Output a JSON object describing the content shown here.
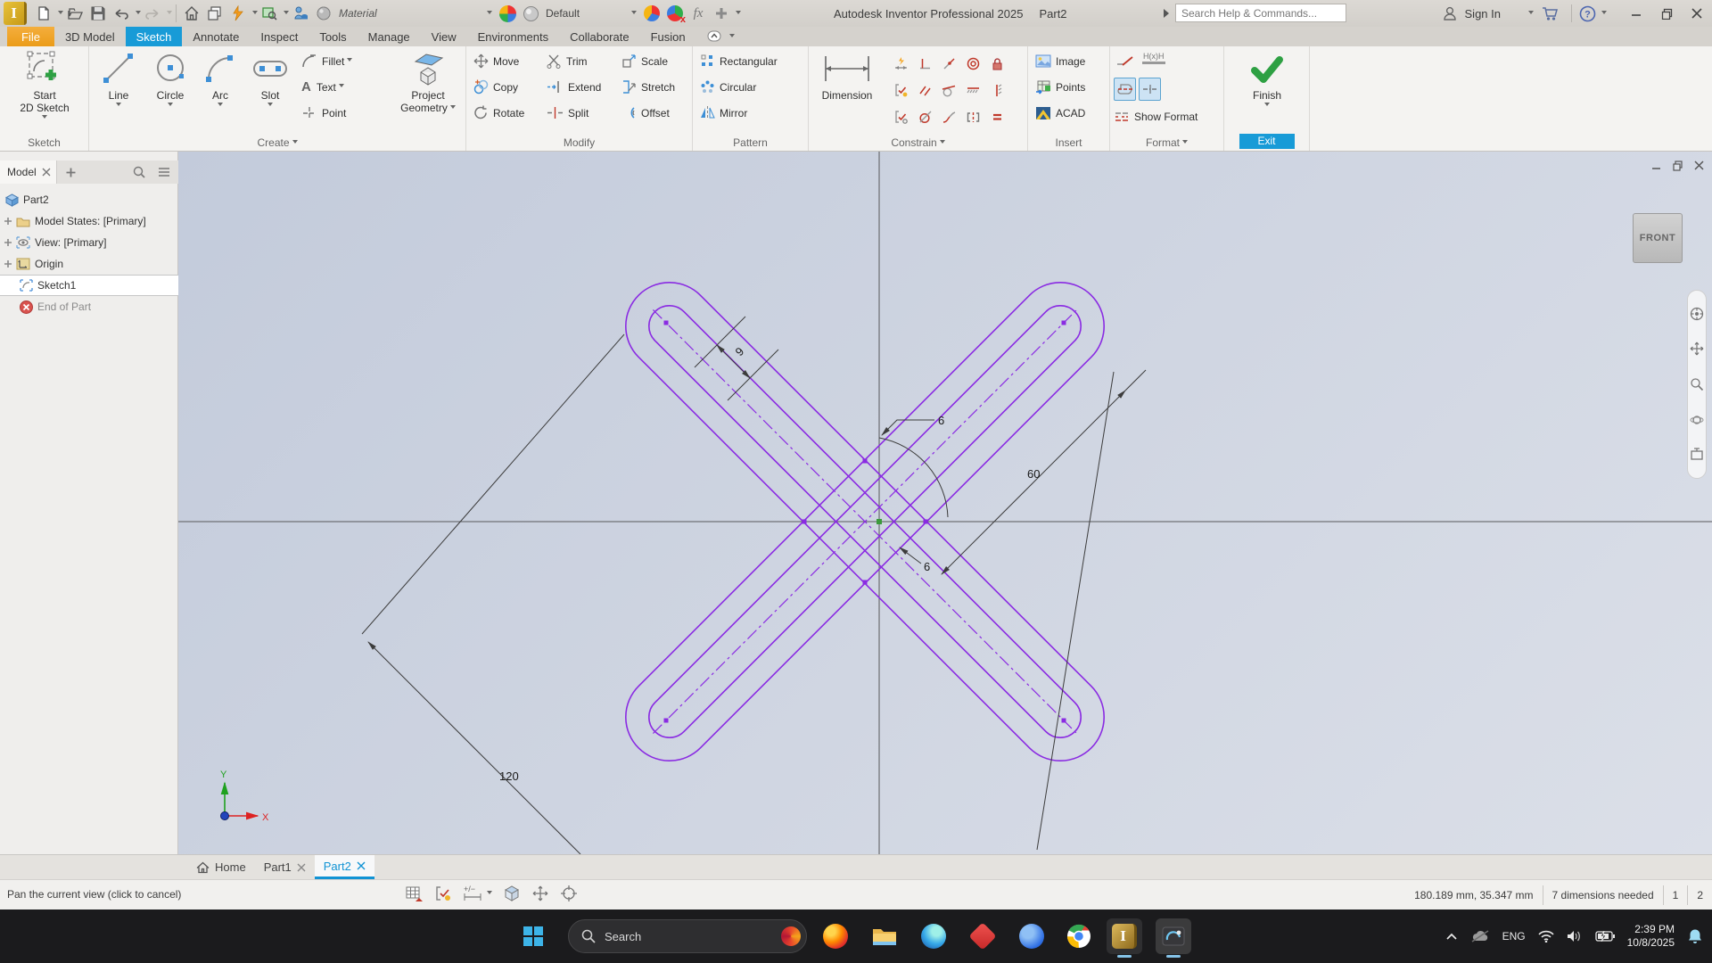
{
  "titlebar": {
    "app_title": "Autodesk Inventor Professional 2025",
    "doc_title": "Part2",
    "material_combo": "Material",
    "appearance_combo": "Default",
    "fx_label": "fx",
    "search_placeholder": "Search Help & Commands...",
    "sign_in_label": "Sign In"
  },
  "ribbon": {
    "tabs": [
      "File",
      "3D Model",
      "Sketch",
      "Annotate",
      "Inspect",
      "Tools",
      "Manage",
      "View",
      "Environments",
      "Collaborate",
      "Fusion"
    ],
    "active_tab": "Sketch",
    "sketch_panel": {
      "label": "Sketch",
      "start_line1": "Start",
      "start_line2": "2D Sketch"
    },
    "create_panel": {
      "label": "Create",
      "big": [
        "Line",
        "Circle",
        "Arc",
        "Slot"
      ],
      "small": [
        "Fillet",
        "Text",
        "Point"
      ],
      "project_line1": "Project",
      "project_line2": "Geometry"
    },
    "modify_panel": {
      "label": "Modify",
      "col1": [
        "Move",
        "Copy",
        "Rotate"
      ],
      "col2": [
        "Trim",
        "Extend",
        "Split"
      ],
      "col3": [
        "Scale",
        "Stretch",
        "Offset"
      ]
    },
    "pattern_panel": {
      "label": "Pattern",
      "items": [
        "Rectangular",
        "Circular",
        "Mirror"
      ]
    },
    "constrain_panel": {
      "label": "Constrain",
      "dimension": "Dimension",
      "icons": [
        [
          "auto-dimension",
          "perpendicular",
          "coincident",
          "concentric",
          "fix"
        ],
        [
          "show-constraints",
          "parallel",
          "tangent",
          "horizontal",
          "vertical"
        ],
        [
          "constraint-settings",
          "collinear",
          "smooth",
          "symmetric",
          "equal"
        ]
      ]
    },
    "insert_panel": {
      "label": "Insert",
      "items": [
        "Image",
        "Points",
        "ACAD"
      ]
    },
    "format_panel": {
      "label": "Format",
      "show_format": "Show Format"
    },
    "exit_panel": {
      "label": "Exit",
      "finish": "Finish"
    }
  },
  "browser": {
    "tab_label": "Model",
    "items": [
      "Part2",
      "Model States: [Primary]",
      "View: [Primary]",
      "Origin",
      "Sketch1",
      "End of Part"
    ]
  },
  "canvas": {
    "viewcube_face": "FRONT",
    "dim_9": "9",
    "dim_6_top": "6",
    "dim_6_bottom": "6",
    "dim_60": "60",
    "dim_120": "120",
    "axis_x_label": "X",
    "axis_y_label": "Y",
    "accent_purple": "#8a2be2",
    "axis_color": "#58595b"
  },
  "doc_tabs": {
    "home": "Home",
    "part1": "Part1",
    "part2": "Part2"
  },
  "status_bar": {
    "message": "Pan the current view (click to cancel)",
    "coordinates": "180.189 mm, 35.347 mm",
    "dimensions_needed": "7 dimensions needed",
    "counter1": "1",
    "counter2": "2"
  },
  "taskbar": {
    "search_placeholder": "Search",
    "language": "ENG",
    "time": "2:39 PM",
    "date": "10/8/2025",
    "app_icons": [
      "firefox",
      "file-explorer",
      "edge",
      "autodesk-access",
      "blue-app",
      "chrome",
      "inventor",
      "capture-tool"
    ]
  },
  "icons": {
    "inventor_logo_glyph": "I",
    "inventor_taskbar_glyph": "I",
    "text_tool_glyph": "A",
    "hxh_glyph": "H(x)H"
  }
}
